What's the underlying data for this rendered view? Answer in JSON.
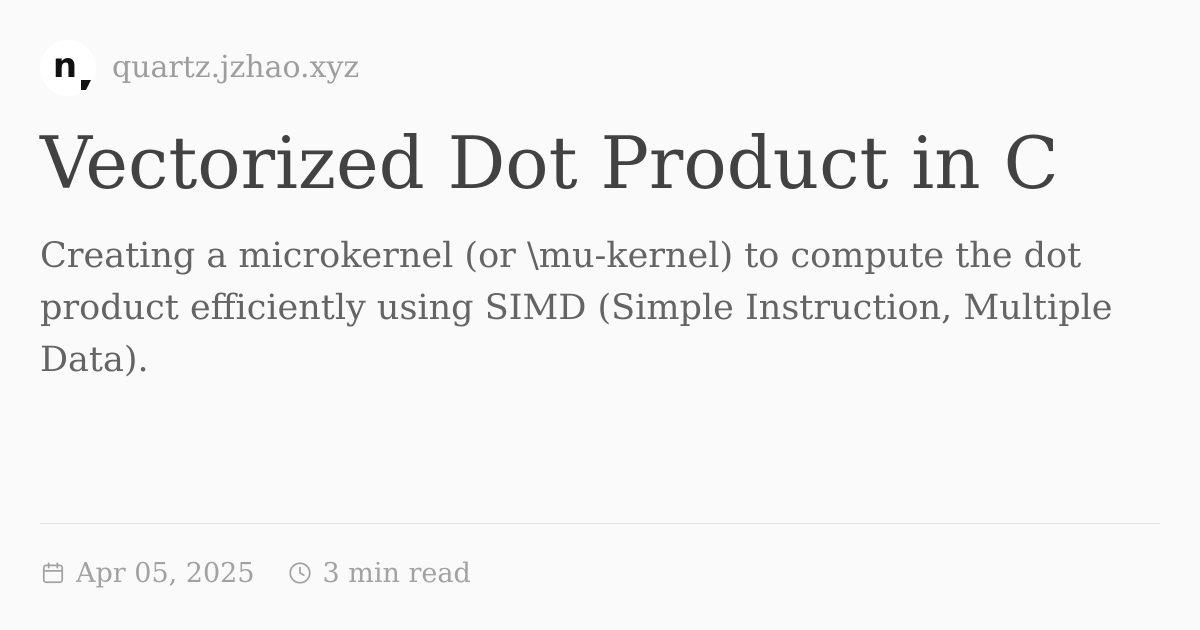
{
  "site": {
    "logo_letter": "n",
    "name": "quartz.jzhao.xyz"
  },
  "article": {
    "title": "Vectorized Dot Product in C",
    "description": "Creating a microkernel (or \\mu-kernel) to compute the dot product efficiently using SIMD (Simple Instruction, Multiple Data).",
    "date": "Apr 05, 2025",
    "reading_time": "3 min read"
  },
  "icons": {
    "date": "calendar-icon",
    "reading_time": "clock-icon"
  },
  "colors": {
    "background": "#fafafa",
    "title": "#424242",
    "description": "#646464",
    "muted": "#a2a2a2",
    "divider": "#e3e3e3"
  }
}
